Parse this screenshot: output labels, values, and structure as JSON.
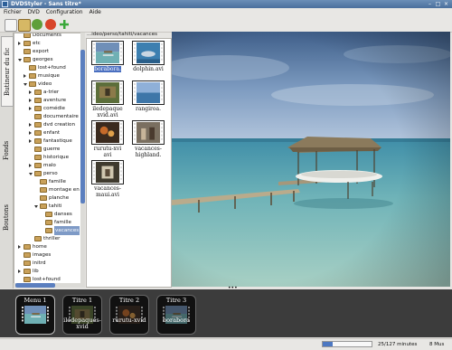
{
  "window": {
    "title": "DVDStyler - Sans titre*"
  },
  "menubar": [
    "Fichier",
    "DVD",
    "Configuration",
    "Aide"
  ],
  "toolbar": [
    {
      "name": "new-project-icon",
      "color": "#f2f2f2"
    },
    {
      "name": "open-project-icon",
      "color": "#d6b865"
    },
    {
      "name": "save-project-icon",
      "color": "#5f9f3a"
    },
    {
      "name": "burn-dvd-icon",
      "color": "#d8452a"
    },
    {
      "name": "add-file-icon",
      "color": "#3aa83a"
    }
  ],
  "side_tabs": {
    "browser": "Butineur du fic",
    "backgrounds": "Fonds",
    "buttons": "Boutons"
  },
  "tree": [
    {
      "label": "Documents",
      "depth": 1,
      "state": "leaf"
    },
    {
      "label": "etc",
      "depth": 1,
      "state": "closed"
    },
    {
      "label": "export",
      "depth": 1,
      "state": "leaf"
    },
    {
      "label": "georges",
      "depth": 1,
      "state": "open"
    },
    {
      "label": "lost+found",
      "depth": 2,
      "state": "leaf"
    },
    {
      "label": "musique",
      "depth": 2,
      "state": "closed"
    },
    {
      "label": "video",
      "depth": 2,
      "state": "open"
    },
    {
      "label": "a-trier",
      "depth": 3,
      "state": "closed"
    },
    {
      "label": "aventure",
      "depth": 3,
      "state": "closed"
    },
    {
      "label": "comédie",
      "depth": 3,
      "state": "closed"
    },
    {
      "label": "documentaire",
      "depth": 3,
      "state": "leaf"
    },
    {
      "label": "dvd creation",
      "depth": 3,
      "state": "closed"
    },
    {
      "label": "enfant",
      "depth": 3,
      "state": "closed"
    },
    {
      "label": "fantastique",
      "depth": 3,
      "state": "closed"
    },
    {
      "label": "guerre",
      "depth": 3,
      "state": "leaf"
    },
    {
      "label": "historique",
      "depth": 3,
      "state": "leaf"
    },
    {
      "label": "malo",
      "depth": 3,
      "state": "closed"
    },
    {
      "label": "perso",
      "depth": 3,
      "state": "open"
    },
    {
      "label": "famille",
      "depth": 4,
      "state": "leaf"
    },
    {
      "label": "montage en",
      "depth": 4,
      "state": "leaf"
    },
    {
      "label": "planche",
      "depth": 4,
      "state": "leaf"
    },
    {
      "label": "tahiti",
      "depth": 4,
      "state": "open"
    },
    {
      "label": "danses",
      "depth": 5,
      "state": "leaf"
    },
    {
      "label": "famille",
      "depth": 5,
      "state": "leaf"
    },
    {
      "label": "vacances",
      "depth": 5,
      "state": "leaf",
      "selected": true
    },
    {
      "label": "thriller",
      "depth": 3,
      "state": "leaf"
    },
    {
      "label": "home",
      "depth": 1,
      "state": "closed"
    },
    {
      "label": "images",
      "depth": 1,
      "state": "leaf"
    },
    {
      "label": "initrd",
      "depth": 1,
      "state": "leaf"
    },
    {
      "label": "lib",
      "depth": 1,
      "state": "closed"
    },
    {
      "label": "lost+found",
      "depth": 1,
      "state": "leaf"
    },
    {
      "label": "marlus",
      "depth": 1,
      "state": "closed"
    }
  ],
  "browser": {
    "path": "...ideo/perso/tahiti/vacances",
    "files": [
      {
        "name": "borabora.",
        "selected": true,
        "scene": "boat"
      },
      {
        "name": "dolphin.avi",
        "scene": "dolphin"
      },
      {
        "name": "iledepaque\nxvid.avi",
        "scene": "island"
      },
      {
        "name": "rangiroa.",
        "scene": "sea"
      },
      {
        "name": "rurutu-xvi\navi",
        "scene": "dance"
      },
      {
        "name": "vacances-\nhighland.",
        "scene": "people"
      },
      {
        "name": "vacances-\nmaui.avi",
        "scene": "beach"
      }
    ]
  },
  "menus": [
    {
      "title": "Menu 1",
      "label": "",
      "scene": "boat",
      "selected": true
    },
    {
      "title": "Titre 1",
      "label": "iledepaques-xvid",
      "scene": "island"
    },
    {
      "title": "Titre 2",
      "label": "rurutu-xvid",
      "scene": "dance"
    },
    {
      "title": "Titre 3",
      "label": "borabora",
      "scene": "boat"
    }
  ],
  "status": {
    "minutes": "25/127 minutes",
    "size": "8 Mus",
    "progress": 0.2
  },
  "colors": {
    "selection": "#4a6fc0",
    "accent": "#5b7fbf",
    "strip_bg": "#3c3c3c"
  }
}
